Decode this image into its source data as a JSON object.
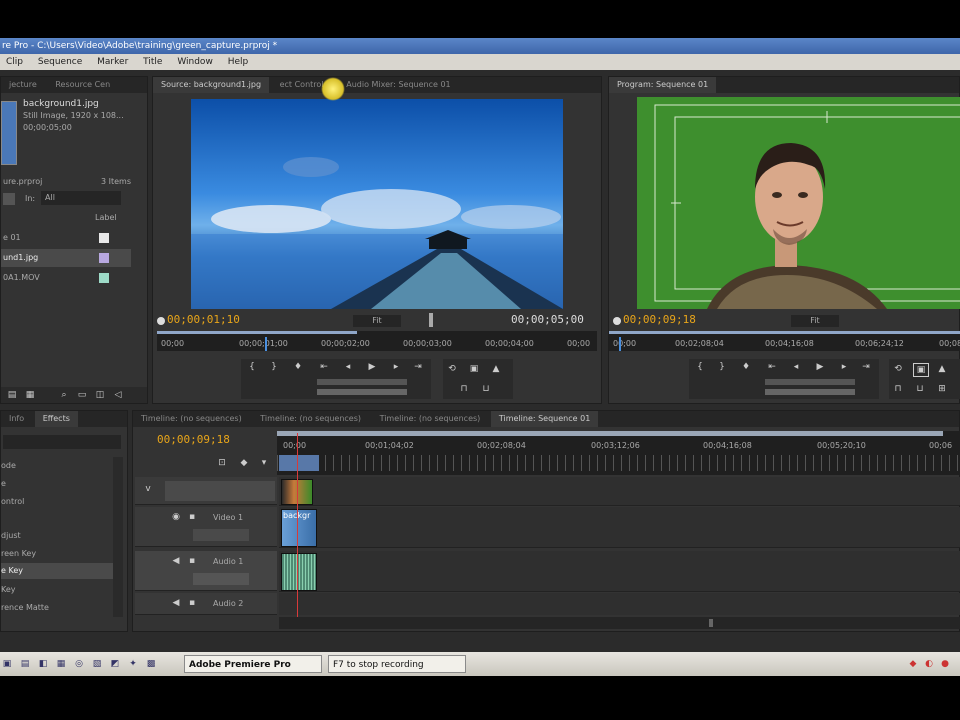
{
  "window": {
    "title": "re Pro - C:\\Users\\Video\\Adobe\\training\\green_capture.prproj *"
  },
  "menu": [
    "Clip",
    "Sequence",
    "Marker",
    "Title",
    "Window",
    "Help"
  ],
  "project": {
    "tabs": [
      "jecture",
      "Resource Cen"
    ],
    "file_name": "background1.jpg",
    "file_info": "Still Image, 1920 x 108...",
    "file_duration": "00;00;05;00",
    "project_name": "ure.prproj",
    "item_count": "3 Items",
    "in_label": "In:",
    "in_value": "All",
    "column_label": "Label",
    "items": [
      {
        "name": "e 01",
        "color": "#e8e8e8"
      },
      {
        "name": "und1.jpg",
        "color": "#b8a8e0"
      },
      {
        "name": "0A1.MOV",
        "color": "#9edbc8"
      }
    ]
  },
  "source_monitor": {
    "tabs": [
      "Source: background1.jpg",
      "ect Controls",
      "Audio Mixer: Sequence 01"
    ],
    "current_time": "00;00;01;10",
    "zoom": "Fit",
    "duration": "00;00;05;00",
    "ruler": [
      "00;00",
      "00;00;01;00",
      "00;00;02;00",
      "00;00;03;00",
      "00;00;04;00",
      "00;00"
    ]
  },
  "program_monitor": {
    "tabs": [
      "Program: Sequence 01"
    ],
    "current_time": "00;00;09;18",
    "zoom": "Fit",
    "ruler": [
      "00;00",
      "00;02;08;04",
      "00;04;16;08",
      "00;06;24;12",
      "00;08"
    ]
  },
  "effects": {
    "tabs": [
      "Info",
      "Effects"
    ],
    "items": [
      "ode",
      "e",
      "ontrol",
      "",
      "djust",
      "reen Key",
      "e Key",
      "Key",
      "rence Matte"
    ],
    "selected_index": 6
  },
  "timeline": {
    "tabs": [
      "Timeline: (no sequences)",
      "Timeline: (no sequences)",
      "Timeline: (no sequences)",
      "Timeline: Sequence 01"
    ],
    "current_time": "00;00;09;18",
    "ruler": [
      "00;00",
      "00;01;04;02",
      "00;02;08;04",
      "00;03;12;06",
      "00;04;16;08",
      "00;05;20;10",
      "00;06"
    ],
    "tracks": {
      "video2": "",
      "video1": "Video 1",
      "audio1": "Audio 1",
      "audio2": "Audio 2"
    },
    "clip_video1": "backgr"
  },
  "taskbar": {
    "items": [
      "Adobe Premiere Pro",
      "F7 to stop recording"
    ]
  },
  "colors": {
    "accent": "#e8a51a",
    "green_screen": "#3e8f2e",
    "sky": "#2f7fd0"
  }
}
